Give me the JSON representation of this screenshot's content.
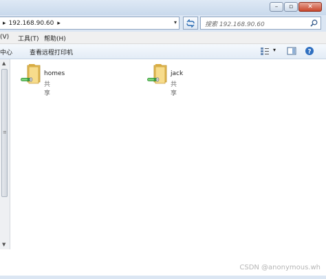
{
  "address": {
    "path": "192.168.90.60"
  },
  "search": {
    "placeholder": "搜索 192.168.90.60"
  },
  "menu": {
    "view": "(V)",
    "tools": "工具(T)",
    "help": "帮助(H)"
  },
  "toolbar": {
    "network_center": "中心",
    "view_printers": "查看远程打印机"
  },
  "items": [
    {
      "name": "homes",
      "type": "共享",
      "icon": "shared-folder-icon"
    },
    {
      "name": "jack",
      "type": "共享",
      "icon": "shared-folder-icon"
    }
  ],
  "watermark": "CSDN @anonymous.wh",
  "colors": {
    "frame": "#dbe6f3",
    "close": "#c9462c",
    "folder": "#f0cd6e"
  }
}
